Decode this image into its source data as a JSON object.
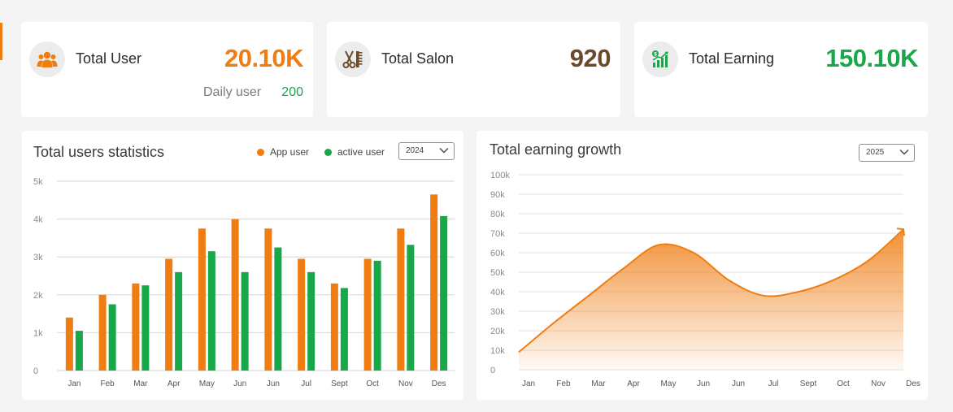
{
  "cards": {
    "total_user": {
      "label": "Total User",
      "value": "20.10K",
      "sub_label": "Daily user",
      "sub_value": "200",
      "value_color": "#ef7d12"
    },
    "total_salon": {
      "label": "Total Salon",
      "value": "920",
      "value_color": "#6b4a2b"
    },
    "total_earning": {
      "label": "Total Earning",
      "value": "150.10K",
      "value_color": "#18a84a"
    }
  },
  "icons": {
    "total_user": "users-icon",
    "total_salon": "scissors-comb-icon",
    "total_earning": "earnings-chart-icon"
  },
  "users_chart": {
    "title": "Total users statistics",
    "legend": {
      "app_user": "App user",
      "active_user": "active user"
    },
    "year": "2024"
  },
  "earning_chart": {
    "title": "Total earning growth",
    "year": "2025"
  },
  "chart_data": [
    {
      "type": "bar",
      "title": "Total users statistics",
      "categories": [
        "Jan",
        "Feb",
        "Mar",
        "Apr",
        "May",
        "Jun",
        "Jun",
        "Jul",
        "Sept",
        "Oct",
        "Nov",
        "Des"
      ],
      "y_ticks": [
        "0",
        "1k",
        "2k",
        "3k",
        "4k",
        "5k"
      ],
      "ylim": [
        0,
        5000
      ],
      "grid": true,
      "legend_position": "top-right",
      "series": [
        {
          "name": "App user",
          "color": "#ef7d12",
          "values": [
            1400,
            2000,
            2300,
            2950,
            3750,
            4000,
            3750,
            2950,
            2300,
            2950,
            3750,
            4650
          ]
        },
        {
          "name": "active user",
          "color": "#18a84a",
          "values": [
            1050,
            1750,
            2250,
            2600,
            3150,
            2600,
            3250,
            2600,
            2180,
            2900,
            3320,
            4080
          ]
        }
      ]
    },
    {
      "type": "area",
      "title": "Total earning growth",
      "categories": [
        "Jan",
        "Feb",
        "Mar",
        "Apr",
        "May",
        "Jun",
        "Jun",
        "Jul",
        "Sept",
        "Oct",
        "Nov",
        "Des"
      ],
      "y_ticks": [
        "0",
        "10k",
        "20k",
        "30k",
        "40k",
        "50k",
        "60k",
        "70k",
        "80k",
        "90k",
        "100k"
      ],
      "ylim": [
        0,
        100000
      ],
      "grid": true,
      "series": [
        {
          "name": "",
          "color": "#ef7d12",
          "values": [
            9000,
            24000,
            38000,
            52000,
            64000,
            60000,
            46000,
            38000,
            40000,
            46000,
            56000,
            72000
          ]
        }
      ]
    }
  ]
}
